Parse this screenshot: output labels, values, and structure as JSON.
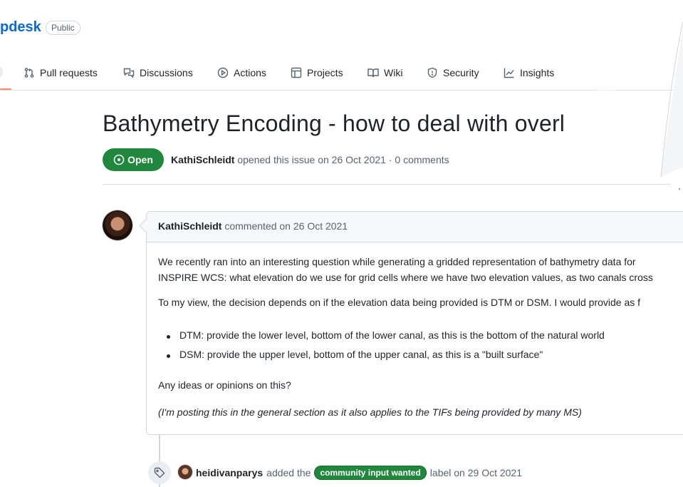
{
  "repo": {
    "name_fragment": "pdesk",
    "visibility": "Public"
  },
  "nav": {
    "items": [
      {
        "label": "Pull requests",
        "icon": "pull-request-icon"
      },
      {
        "label": "Discussions",
        "icon": "discussions-icon"
      },
      {
        "label": "Actions",
        "icon": "play-icon"
      },
      {
        "label": "Projects",
        "icon": "table-icon"
      },
      {
        "label": "Wiki",
        "icon": "book-icon"
      },
      {
        "label": "Security",
        "icon": "shield-icon"
      },
      {
        "label": "Insights",
        "icon": "graph-icon"
      }
    ]
  },
  "issue": {
    "title": "Bathymetry Encoding - how to deal with overl",
    "state": "Open",
    "author": "KathiSchleidt",
    "opened_text": "opened this issue on 26 Oct 2021 · 0 comments"
  },
  "comment": {
    "author": "KathiSchleidt",
    "commented_text": "commented on 26 Oct 2021",
    "paragraph1_line1": "We recently ran into an interesting question while generating a gridded representation of bathymetry data for",
    "paragraph1_line2": "INSPIRE WCS: what elevation do we use for grid cells where we have two elevation values, as two canals cross",
    "paragraph2": "To my view, the decision depends on if the elevation data being provided is DTM or DSM. I would provide as f",
    "bullets": [
      "DTM: provide the lower level, bottom of the lower canal, as this is the bottom of the natural world",
      "DSM: provide the upper level, bottom of the upper canal, as this is a \"built surface\""
    ],
    "question": "Any ideas or opinions on this?",
    "note": "(I'm posting this in the general section as it also applies to the TIFs being provided by many MS)"
  },
  "timeline_event": {
    "actor": "heidivanparys",
    "action": "added the",
    "label": "community input wanted",
    "suffix": "label on 29 Oct 2021"
  },
  "colors": {
    "accent": "#0969da",
    "open_green": "#1f883d",
    "nav_underline": "#fd8c73"
  }
}
